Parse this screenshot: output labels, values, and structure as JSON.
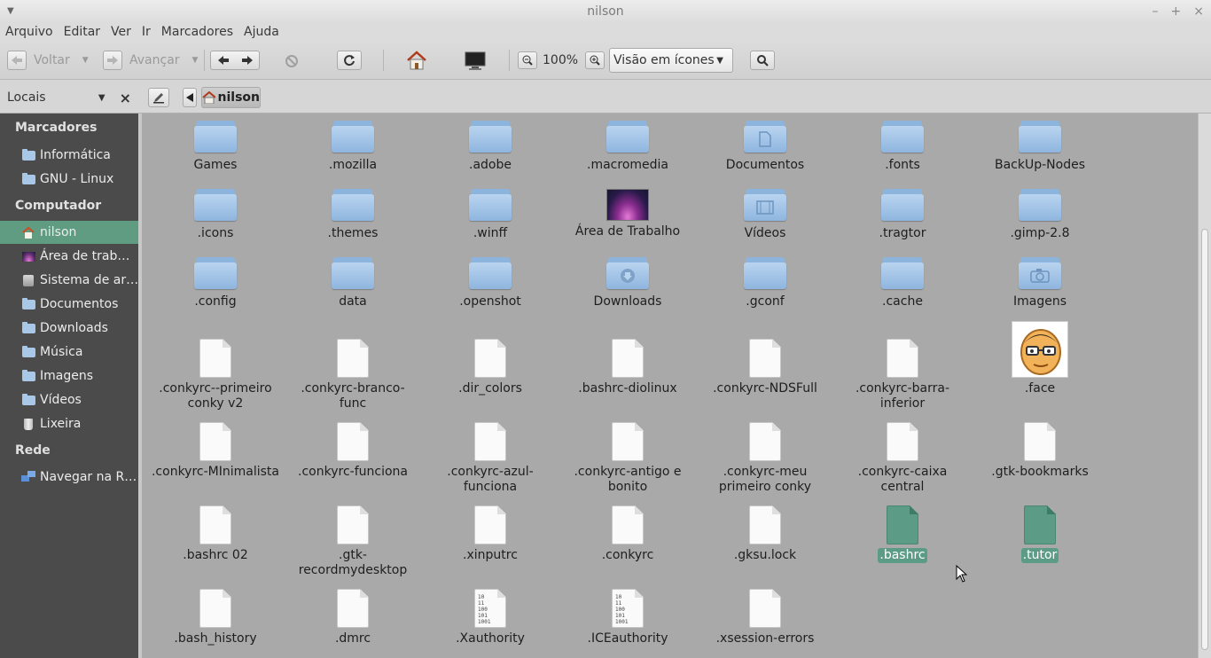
{
  "window": {
    "title": "nilson",
    "minimize": "–",
    "maximize": "+",
    "close": "×",
    "menu_arrow": "▼"
  },
  "menubar": [
    "Arquivo",
    "Editar",
    "Ver",
    "Ir",
    "Marcadores",
    "Ajuda"
  ],
  "toolbar": {
    "back": "Voltar",
    "forward": "Avançar",
    "zoom": "100%",
    "view_mode": "Visão em ícones"
  },
  "location": {
    "sidebar_mode": "Locais",
    "path": "nilson"
  },
  "sidebar": {
    "sections": [
      {
        "title": "Marcadores",
        "items": [
          {
            "label": "Informática",
            "icon": "folder-icon"
          },
          {
            "label": "GNU - Linux",
            "icon": "folder-icon"
          }
        ]
      },
      {
        "title": "Computador",
        "items": [
          {
            "label": "nilson",
            "icon": "home-icon",
            "active": true
          },
          {
            "label": "Área de trab…",
            "icon": "desktop-icon"
          },
          {
            "label": "Sistema de ar…",
            "icon": "drive-icon"
          },
          {
            "label": "Documentos",
            "icon": "folder-icon"
          },
          {
            "label": "Downloads",
            "icon": "folder-icon"
          },
          {
            "label": "Música",
            "icon": "folder-icon"
          },
          {
            "label": "Imagens",
            "icon": "folder-icon"
          },
          {
            "label": "Vídeos",
            "icon": "folder-icon"
          },
          {
            "label": "Lixeira",
            "icon": "trash-icon"
          }
        ]
      },
      {
        "title": "Rede",
        "items": [
          {
            "label": "Navegar na R…",
            "icon": "network-icon"
          }
        ]
      }
    ]
  },
  "files": [
    {
      "label": "Games",
      "type": "folder"
    },
    {
      "label": ".mozilla",
      "type": "folder"
    },
    {
      "label": ".adobe",
      "type": "folder"
    },
    {
      "label": ".macromedia",
      "type": "folder"
    },
    {
      "label": "Documentos",
      "type": "folder",
      "emblem": "document"
    },
    {
      "label": ".fonts",
      "type": "folder"
    },
    {
      "label": "BackUp-Nodes",
      "type": "folder"
    },
    {
      "label": ".icons",
      "type": "folder"
    },
    {
      "label": ".themes",
      "type": "folder"
    },
    {
      "label": ".winff",
      "type": "folder"
    },
    {
      "label": "Área de Trabalho",
      "type": "desktop"
    },
    {
      "label": "Vídeos",
      "type": "folder",
      "emblem": "film"
    },
    {
      "label": ".tragtor",
      "type": "folder"
    },
    {
      "label": ".gimp-2.8",
      "type": "folder"
    },
    {
      "label": ".config",
      "type": "folder"
    },
    {
      "label": "data",
      "type": "folder"
    },
    {
      "label": ".openshot",
      "type": "folder"
    },
    {
      "label": "Downloads",
      "type": "folder",
      "emblem": "download"
    },
    {
      "label": ".gconf",
      "type": "folder"
    },
    {
      "label": ".cache",
      "type": "folder"
    },
    {
      "label": "Imagens",
      "type": "folder",
      "emblem": "camera"
    },
    {
      "label": ".conkyrc--primeiro conky v2",
      "type": "file"
    },
    {
      "label": ".conkyrc-branco-func",
      "type": "file"
    },
    {
      "label": ".dir_colors",
      "type": "file"
    },
    {
      "label": ".bashrc-diolinux",
      "type": "file"
    },
    {
      "label": ".conkyrc-NDSFull",
      "type": "file"
    },
    {
      "label": ".conkyrc-barra-inferior",
      "type": "file"
    },
    {
      "label": ".face",
      "type": "face"
    },
    {
      "label": ".conkyrc-MInimalista",
      "type": "file"
    },
    {
      "label": ".conkyrc-funciona",
      "type": "file"
    },
    {
      "label": ".conkyrc-azul-funciona",
      "type": "file"
    },
    {
      "label": ".conkyrc-antigo e bonito",
      "type": "file"
    },
    {
      "label": ".conkyrc-meu primeiro conky",
      "type": "file"
    },
    {
      "label": ".conkyrc-caixa central",
      "type": "file"
    },
    {
      "label": ".gtk-bookmarks",
      "type": "file"
    },
    {
      "label": ".bashrc 02",
      "type": "file"
    },
    {
      "label": ".gtk-recordmydesktop",
      "type": "file"
    },
    {
      "label": ".xinputrc",
      "type": "file"
    },
    {
      "label": ".conkyrc",
      "type": "file"
    },
    {
      "label": ".gksu.lock",
      "type": "file"
    },
    {
      "label": ".bashrc",
      "type": "file",
      "selected": true
    },
    {
      "label": ".tutor",
      "type": "file",
      "selected": true
    },
    {
      "label": ".bash_history",
      "type": "file"
    },
    {
      "label": ".dmrc",
      "type": "file"
    },
    {
      "label": ".Xauthority",
      "type": "binary"
    },
    {
      "label": ".ICEauthority",
      "type": "binary"
    },
    {
      "label": ".xsession-errors",
      "type": "file"
    }
  ],
  "binary_glyph": "10\n11\n100\n101\n1001",
  "colors": {
    "sidebar_bg": "#4b4b4b",
    "selection": "#5c9c87",
    "folder": "#8fb6df",
    "content_bg": "#a9a9a9"
  }
}
